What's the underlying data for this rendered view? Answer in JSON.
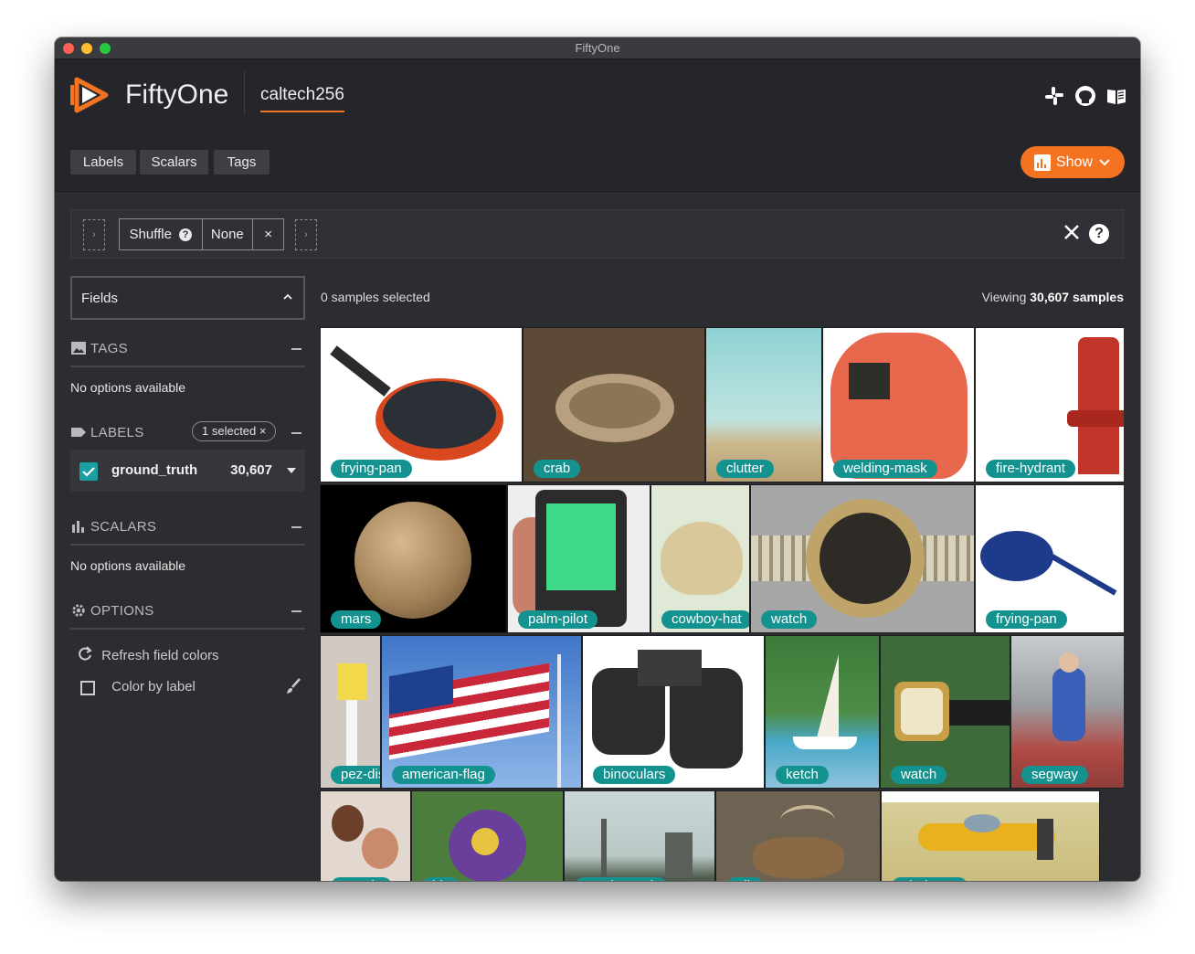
{
  "window": {
    "title": "FiftyOne"
  },
  "header": {
    "app_name": "FiftyOne",
    "dataset": "caltech256"
  },
  "toolbar": {
    "tabs": [
      "Labels",
      "Scalars",
      "Tags"
    ],
    "show_label": "Show"
  },
  "view_bar": {
    "stage_name": "Shuffle",
    "stage_help": "?",
    "stage_value": "None",
    "stage_remove": "×",
    "left_arrow": "›",
    "right_arrow": "›"
  },
  "sidebar": {
    "fields_title": "Fields",
    "tags": {
      "title": "TAGS",
      "empty": "No options available"
    },
    "labels": {
      "title": "LABELS",
      "selected_badge": "1 selected ×",
      "field_name": "ground_truth",
      "field_count": "30,607"
    },
    "scalars": {
      "title": "SCALARS",
      "empty": "No options available"
    },
    "options": {
      "title": "OPTIONS",
      "refresh": "Refresh field colors",
      "color_by_label": "Color by label"
    }
  },
  "main": {
    "selected": "0 samples selected",
    "viewing_prefix": "Viewing ",
    "viewing_count": "30,607 samples"
  },
  "colors": {
    "accent": "#f37321",
    "label_bg": "#14928f",
    "checkbox": "#1aa0a0",
    "background": "#2b2d31"
  },
  "samples": [
    {
      "label": "frying-pan"
    },
    {
      "label": "crab"
    },
    {
      "label": "clutter"
    },
    {
      "label": "welding-mask"
    },
    {
      "label": "fire-hydrant"
    },
    {
      "label": "mars"
    },
    {
      "label": "palm-pilot"
    },
    {
      "label": "cowboy-hat"
    },
    {
      "label": "watch"
    },
    {
      "label": "frying-pan"
    },
    {
      "label": "pez-dispenser"
    },
    {
      "label": "american-flag"
    },
    {
      "label": "binoculars"
    },
    {
      "label": "ketch"
    },
    {
      "label": "watch"
    },
    {
      "label": "segway"
    },
    {
      "label": "people"
    },
    {
      "label": "iris"
    },
    {
      "label": "smokestack"
    },
    {
      "label": "elk"
    },
    {
      "label": "airplanes"
    }
  ]
}
